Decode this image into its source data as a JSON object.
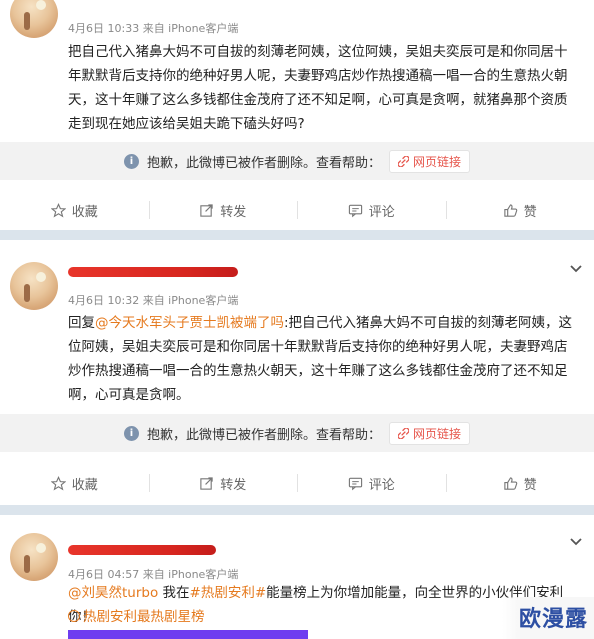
{
  "posts": [
    {
      "meta": "4月6日 10:33 来自 iPhone客户端",
      "text": "把自己代入猪鼻大妈不可自拔的刻薄老阿姨，这位阿姨，吴姐夫奕辰可是和你同居十年默默背后支持你的绝种好男人呢，夫妻野鸡店炒作热搜通稿一唱一合的生意热火朝天，这十年赚了这么多钱都住金茂府了还不知足啊，心可真是贪啊，就猪鼻那个资质走到现在她应该给吴姐夫跪下磕头好吗?",
      "deleted_notice": "抱歉，此微博已被作者删除。查看帮助：",
      "link_label": "网页链接",
      "actions": {
        "favorite": "收藏",
        "repost": "转发",
        "comment": "评论",
        "like": "赞"
      }
    },
    {
      "meta": "4月6日 10:32 来自 iPhone客户端",
      "reply_prefix": "回复",
      "mention": "@今天水军头子贾士凯被端了吗",
      "text": ":把自己代入猪鼻大妈不可自拔的刻薄老阿姨，这位阿姨，吴姐夫奕辰可是和你同居十年默默背后支持你的绝种好男人呢，夫妻野鸡店炒作热搜通稿一唱一合的生意热火朝天，这十年赚了这么多钱都住金茂府了还不知足啊，心可真是贪啊。",
      "deleted_notice": "抱歉，此微博已被作者删除。查看帮助：",
      "link_label": "网页链接",
      "actions": {
        "favorite": "收藏",
        "repost": "转发",
        "comment": "评论",
        "like": "赞"
      }
    },
    {
      "meta": "4月6日 04:57 来自 iPhone客户端",
      "mention": "@刘昊然turbo",
      "text_a": " 我在",
      "topic": "#热剧安利#",
      "text_b": "能量榜上为你增加能量，向全世界的小伙伴们安利你！",
      "hot_link": "热剧安利最热剧星榜"
    }
  ],
  "watermark": "欧漫露",
  "colors": {
    "accent_orange": "#e57a1f",
    "link_red": "#e6554b",
    "redact_red": "#d7261f",
    "separator": "#dbe4ec"
  },
  "icons": [
    "chevron-down-icon",
    "info-icon",
    "link-icon",
    "star-icon",
    "repost-icon",
    "comment-icon",
    "like-icon",
    "fire-icon"
  ]
}
